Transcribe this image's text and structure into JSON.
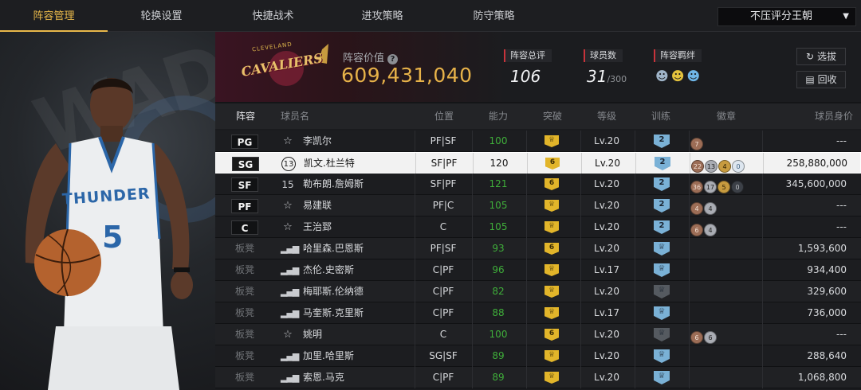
{
  "nav": {
    "tabs": [
      {
        "label": "阵容管理",
        "active": true
      },
      {
        "label": "轮换设置",
        "active": false
      },
      {
        "label": "快捷战术",
        "active": false
      },
      {
        "label": "进攻策略",
        "active": false
      },
      {
        "label": "防守策略",
        "active": false
      }
    ],
    "dropdown_value": "不压评分王朝"
  },
  "hero": {
    "jersey_text": "THUNDER",
    "jersey_number": "5",
    "background_text": "WADE"
  },
  "team": {
    "logo_text": "CAVALIERS",
    "logo_subtext": "CLEVELAND",
    "value_label": "阵容价值",
    "value": "609,431,040",
    "total_rating_label": "阵容总评",
    "total_rating": "106",
    "player_count_label": "球员数",
    "player_count": "31",
    "player_count_max": "/300",
    "bond_label": "阵容羁绊",
    "scout_button": "选拔",
    "recycle_button": "回收"
  },
  "table": {
    "headers": [
      "阵容",
      "球员名",
      "位置",
      "能力",
      "突破",
      "等级",
      "训练",
      "徽章",
      "球员身价"
    ],
    "rows": [
      {
        "slot": "PG",
        "bench": false,
        "icon": "star",
        "name": "李凯尔",
        "position": "PF|SF",
        "ability": "100",
        "breakthrough": "",
        "level": "Lv.20",
        "training": "2",
        "training_style": "blue",
        "medals": [
          {
            "v": "7",
            "c": "bronze"
          }
        ],
        "price": "---",
        "selected": false
      },
      {
        "slot": "SG",
        "bench": false,
        "icon": "13",
        "name": "凯文.杜兰特",
        "position": "SF|PF",
        "ability": "120",
        "breakthrough": "6",
        "level": "Lv.20",
        "training": "2",
        "training_style": "blue",
        "medals": [
          {
            "v": "22",
            "c": "bronze"
          },
          {
            "v": "13",
            "c": "silver"
          },
          {
            "v": "4",
            "c": "gold"
          },
          {
            "v": "0",
            "c": "white"
          }
        ],
        "price": "258,880,000",
        "selected": true
      },
      {
        "slot": "SF",
        "bench": false,
        "icon": "15",
        "name": "勒布朗.詹姆斯",
        "position": "SF|PF",
        "ability": "121",
        "breakthrough": "6",
        "level": "Lv.20",
        "training": "2",
        "training_style": "blue",
        "medals": [
          {
            "v": "36",
            "c": "bronze"
          },
          {
            "v": "17",
            "c": "silver"
          },
          {
            "v": "5",
            "c": "gold"
          },
          {
            "v": "0",
            "c": "dark"
          }
        ],
        "price": "345,600,000",
        "selected": false
      },
      {
        "slot": "PF",
        "bench": false,
        "icon": "star",
        "name": "易建联",
        "position": "PF|C",
        "ability": "105",
        "breakthrough": "",
        "level": "Lv.20",
        "training": "2",
        "training_style": "blue",
        "medals": [
          {
            "v": "4",
            "c": "bronze"
          },
          {
            "v": "4",
            "c": "silver"
          }
        ],
        "price": "---",
        "selected": false
      },
      {
        "slot": "C",
        "bench": false,
        "icon": "star",
        "name": "王治郅",
        "position": "C",
        "ability": "105",
        "breakthrough": "",
        "level": "Lv.20",
        "training": "2",
        "training_style": "blue",
        "medals": [
          {
            "v": "6",
            "c": "bronze"
          },
          {
            "v": "4",
            "c": "silver"
          }
        ],
        "price": "---",
        "selected": false
      },
      {
        "slot": "板凳",
        "bench": true,
        "icon": "bar",
        "name": "哈里森.巴恩斯",
        "position": "PF|SF",
        "ability": "93",
        "breakthrough": "6",
        "level": "Lv.20",
        "training": "",
        "training_style": "blue",
        "medals": [],
        "price": "1,593,600",
        "selected": false
      },
      {
        "slot": "板凳",
        "bench": true,
        "icon": "bar",
        "name": "杰伦.史密斯",
        "position": "C|PF",
        "ability": "96",
        "breakthrough": "",
        "level": "Lv.17",
        "training": "",
        "training_style": "blue",
        "medals": [],
        "price": "934,400",
        "selected": false
      },
      {
        "slot": "板凳",
        "bench": true,
        "icon": "bar",
        "name": "梅耶斯.伦纳德",
        "position": "C|PF",
        "ability": "82",
        "breakthrough": "",
        "level": "Lv.20",
        "training": "",
        "training_style": "dark",
        "medals": [],
        "price": "329,600",
        "selected": false
      },
      {
        "slot": "板凳",
        "bench": true,
        "icon": "bar",
        "name": "马奎斯.克里斯",
        "position": "C|PF",
        "ability": "88",
        "breakthrough": "",
        "level": "Lv.17",
        "training": "",
        "training_style": "blue",
        "medals": [],
        "price": "736,000",
        "selected": false
      },
      {
        "slot": "板凳",
        "bench": true,
        "icon": "star",
        "name": "姚明",
        "position": "C",
        "ability": "100",
        "breakthrough": "6",
        "level": "Lv.20",
        "training": "",
        "training_style": "dark",
        "medals": [
          {
            "v": "6",
            "c": "bronze"
          },
          {
            "v": "6",
            "c": "silver"
          }
        ],
        "price": "---",
        "selected": false
      },
      {
        "slot": "板凳",
        "bench": true,
        "icon": "bar",
        "name": "加里.哈里斯",
        "position": "SG|SF",
        "ability": "89",
        "breakthrough": "",
        "level": "Lv.20",
        "training": "",
        "training_style": "blue",
        "medals": [],
        "price": "288,640",
        "selected": false
      },
      {
        "slot": "板凳",
        "bench": true,
        "icon": "bar",
        "name": "索恩.马克",
        "position": "C|PF",
        "ability": "89",
        "breakthrough": "",
        "level": "Lv.20",
        "training": "",
        "training_style": "blue",
        "medals": [],
        "price": "1,068,800",
        "selected": false
      }
    ]
  },
  "colors": {
    "accent": "#e8b84a",
    "team_red": "#c8333b",
    "ability_green": "#3fae3a",
    "train_blue": "#7ab1d6"
  }
}
